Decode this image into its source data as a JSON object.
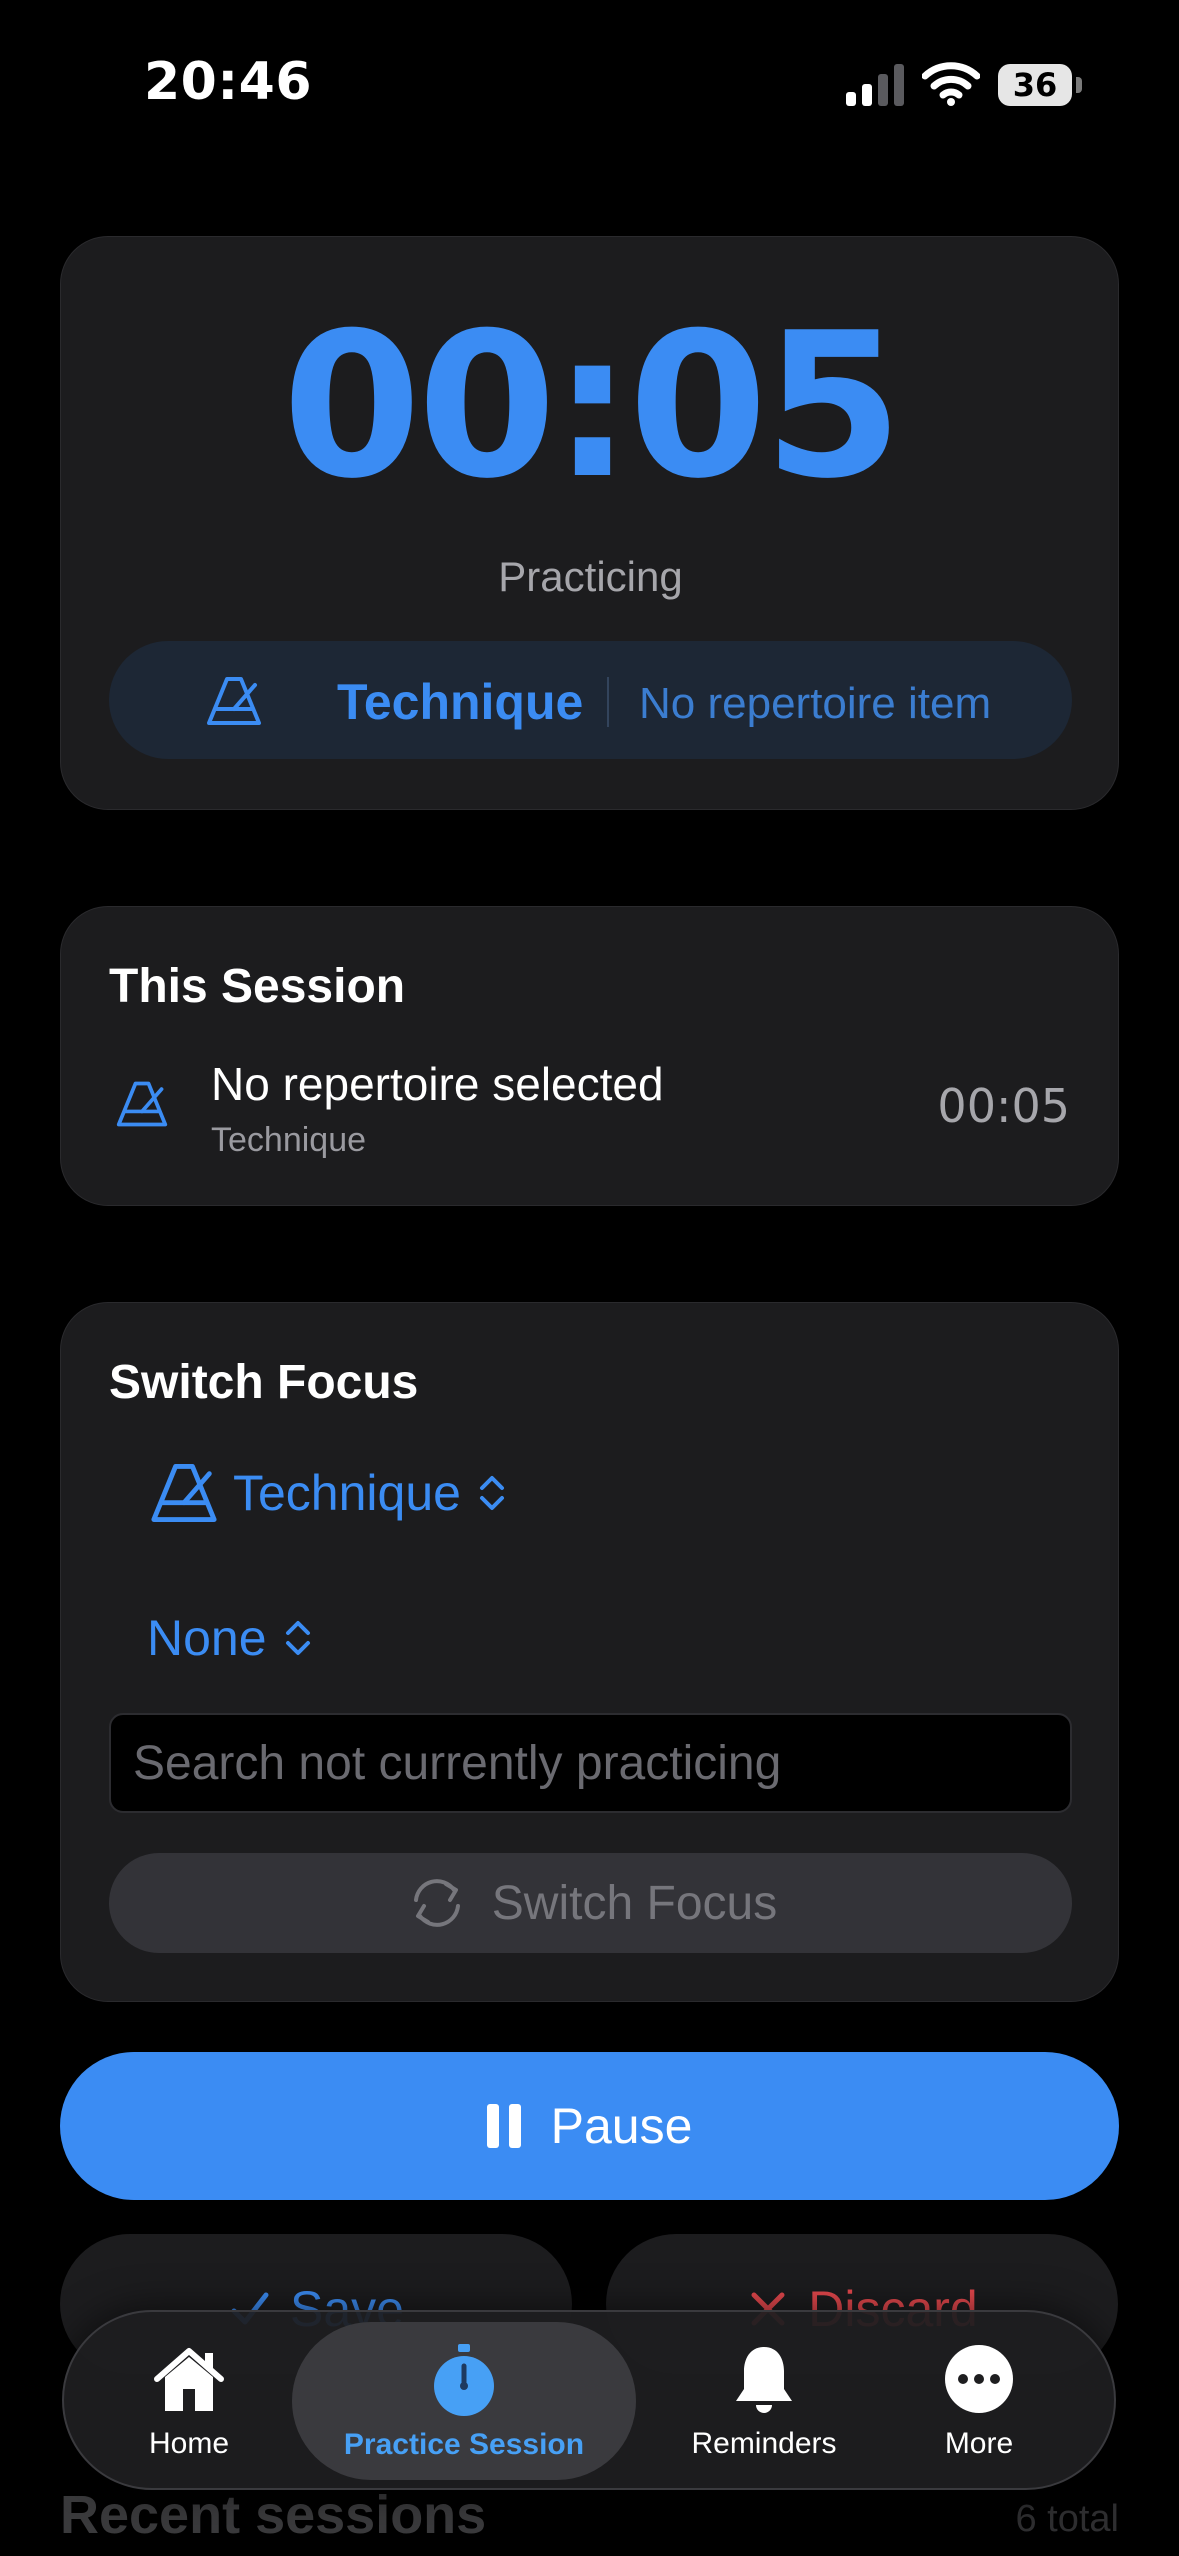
{
  "status_bar": {
    "time": "20:46",
    "battery": "36"
  },
  "timer_card": {
    "time": "00:05",
    "status": "Practicing",
    "category": "Technique",
    "repertoire": "No repertoire item"
  },
  "session_card": {
    "title": "This Session",
    "item_name": "No repertoire selected",
    "item_category": "Technique",
    "item_time": "00:05"
  },
  "switch_card": {
    "title": "Switch Focus",
    "category_select": "Technique",
    "repertoire_select": "None",
    "search_placeholder": "Search not currently practicing",
    "button_label": "Switch Focus"
  },
  "actions": {
    "pause_label": "Pause",
    "save_label": "Save",
    "discard_label": "Discard"
  },
  "recent": {
    "title": "Recent sessions",
    "count": "6 total"
  },
  "tabbar": {
    "home": "Home",
    "practice": "Practice Session",
    "reminders": "Reminders",
    "more": "More"
  },
  "colors": {
    "accent": "#3b8cf3",
    "destructive": "#e5484d",
    "card": "#1c1c1e",
    "background": "#000000"
  }
}
